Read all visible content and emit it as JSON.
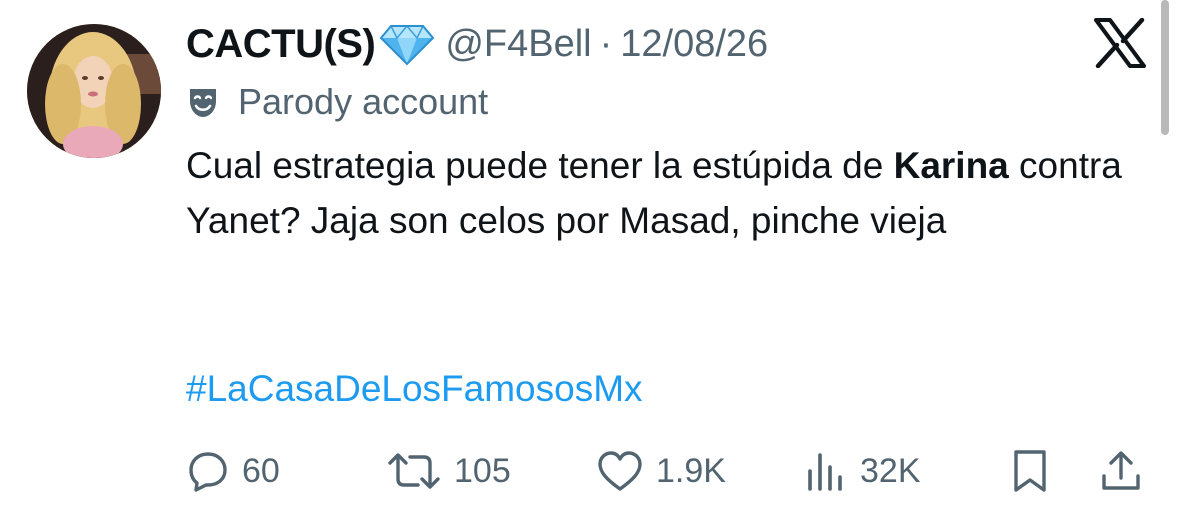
{
  "tweet": {
    "display_name": "CACTU(S)",
    "handle": "@F4Bell",
    "separator": "·",
    "date": "12/08/26",
    "parody_label": "Parody account",
    "text_part1": "Cual estrategia puede tener la estúpida de ",
    "text_bold": "Karina",
    "text_part2": " contra Yanet? Jaja son celos por Masad, pinche vieja",
    "hashtag": "#LaCasaDeLosFamososMx"
  },
  "icons": {
    "verified": "diamond-icon",
    "platform_logo": "x-logo-icon",
    "parody": "theater-mask-icon",
    "reply": "speech-bubble-icon",
    "repost": "repost-arrows-icon",
    "like": "heart-icon",
    "views": "bar-chart-icon",
    "bookmark": "bookmark-icon",
    "share": "share-upload-icon"
  },
  "metrics": {
    "replies": "60",
    "reposts": "105",
    "likes": "1.9K",
    "views": "32K"
  },
  "colors": {
    "text_primary": "#0f1419",
    "text_secondary": "#536471",
    "link": "#1d9bf0",
    "diamond": "#6ec6f5"
  }
}
